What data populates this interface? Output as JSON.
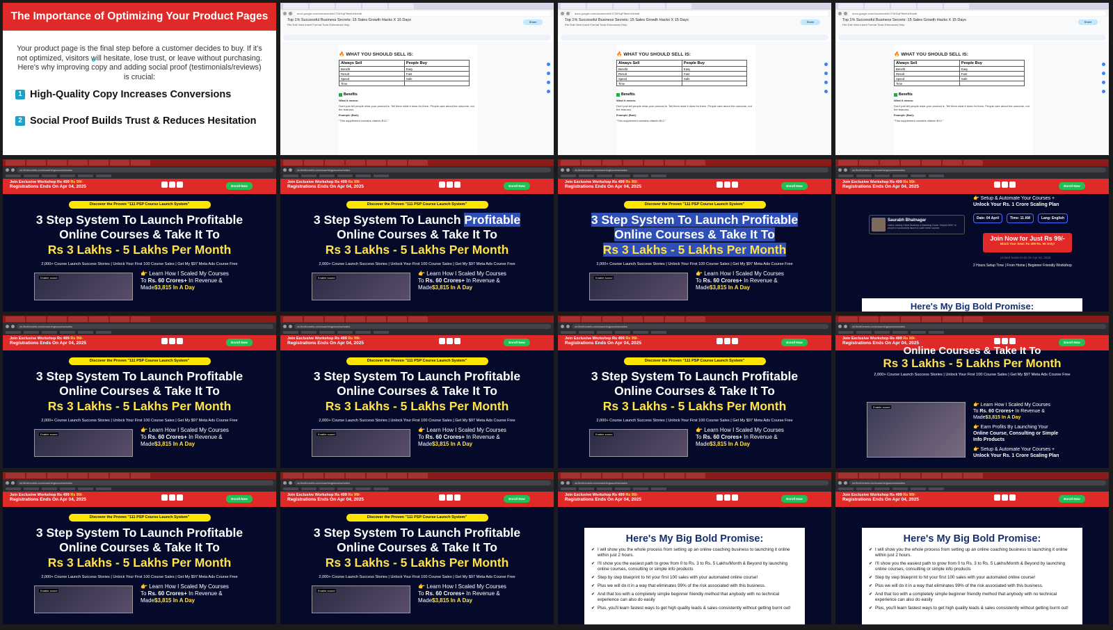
{
  "slide": {
    "title": "The Importance of Optimizing Your Product Pages",
    "body": "Your product page is the final step before a customer decides to buy. If it's not optimized, visitors will hesitate, lose trust, or leave without purchasing. Here's why improving copy and adding social proof (testimonials/reviews) is crucial:",
    "point1_num": "1",
    "point1": "High-Quality Copy Increases Conversions",
    "point2_num": "2",
    "point2": "Social Proof Builds Trust & Reduces Hesitation"
  },
  "docs": {
    "url": "docs.google.com/document/d/1TNH1qF6fmfuHlr/edit",
    "title": "Top 1% Successful Business Secrets: 15 Sales Growth Hacks X 15 Days",
    "menu": "File  Edit  View  Insert  Format  Tools  Extensions  Help",
    "share": "Share",
    "heading": "WHAT YOU SHOULD SELL IS:",
    "col1": "Always Sell",
    "col2": "People Buy",
    "rows": [
      [
        "Benefit",
        "Easy"
      ],
      [
        "Result",
        "Fast"
      ],
      [
        "Speed",
        "Safe"
      ],
      [
        "Time",
        ""
      ]
    ],
    "benefits": "Benefits",
    "what_means": "What it means:",
    "what_text": "Don't just tell people what your product is. Tell them what it does for them. People care about the outcome, not the features.",
    "example": "Example (Bad):",
    "example_text": "\"This supplement contains vitamin B12.\""
  },
  "landing": {
    "url": "ck.flexifunnels.com/coachingsuccess/sales",
    "banner_line1_a": "Join Exclusive Workshop Rs 499",
    "banner_line1_b": "Rs 99/-",
    "banner_line2": "Registrations Ends On Apr 04, 2025",
    "enroll": "Enroll Now",
    "pill": "Discover the Proven \"111 PSP Course Launch System\"",
    "headline_a": "3 Step System To Launch Profitable",
    "headline_b": "Online Courses & Take It To",
    "headline_c": "Rs 3 Lakhs - 5 Lakhs Per Month",
    "stats": "2,000+ Course Launch Success Stories | Unlock Your First 100 Course Sales | Get My $97 Meta Ads Course Free",
    "enable_sound": "Enable sound",
    "learn_a": "Learn How I Scaled My Courses",
    "learn_b_pre": "To ",
    "learn_b_bold": "Rs. 60 Crores+",
    "learn_b_post": " In Revenue &",
    "learn_c_pre": "Made",
    "learn_c_yel": "$3,815 In A Day",
    "earn_a": "Earn Profits By Launching Your",
    "earn_b": "Online Course, Consulting or Simple",
    "earn_c": "Info Products",
    "setup_a": "Setup & Automate Your Courses +",
    "setup_b": "Unlock Your Rs. 1 Crore Scaling Plan",
    "host_name": "Saurabh Bhatnagar",
    "host_desc": "India's Leading Online Business & Marketing Coach. Helped 2000+ of people to successfully launch & scale online courses",
    "date": "Date: 04 April",
    "time": "Time: 11 AM",
    "lang": "Lang: English",
    "join_now": "Join Now for Just Rs 99/-",
    "block_seat": "Block Your Seat: Rs 499 Rs. 99 Only!",
    "limited": "Limited Seats Ends On Apr 04, 2025",
    "setup_time": "2 Hours Setup Time | From Home | Beginner Friendly Workshop",
    "promise_title": "Here's My Big Bold Promise:",
    "promise_items": [
      "I will show you the whole process from setting up an online coaching business to launching it online within just 2 hours.",
      "I'll show you the easiest path to grow from 0 to Rs. 3 to Rs. 5 Lakhs/Month & Beyond by launching online courses, consulting or simple info products",
      "Step by step blueprint to hit your first 100 sales with your automated online course!",
      "Plus we will do it in a way that eliminates 99% of the risk associated with this business.",
      "And that too with a completely simple beginner friendly method that anybody with no technical experience can also do easily",
      "Plus, you'll learn fastest ways to get high quality leads & sales consistently without getting burnt out!"
    ]
  }
}
